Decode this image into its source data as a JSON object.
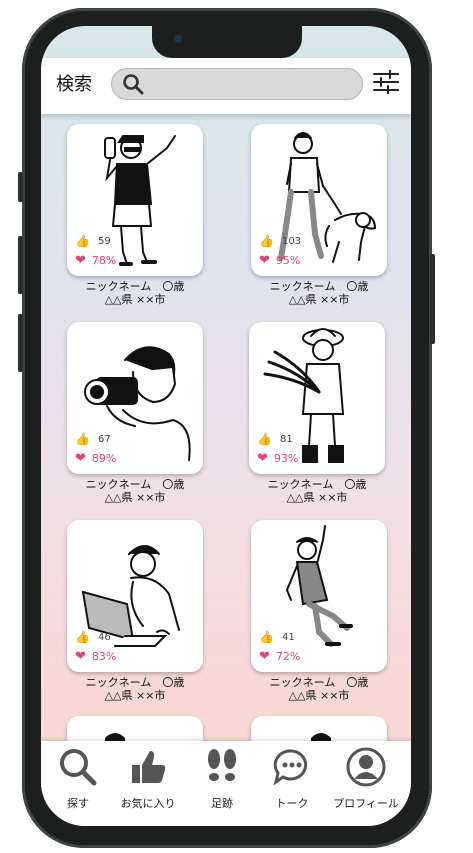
{
  "header": {
    "title": "検索",
    "search_placeholder": ""
  },
  "cards": [
    {
      "likes": "59",
      "rate": "78%",
      "name": "ニックネーム　〇歳",
      "place": "△△県 ××市",
      "illustration": "man-holding-bottle"
    },
    {
      "likes": "103",
      "rate": "95%",
      "name": "ニックネーム　〇歳",
      "place": "△△県 ××市",
      "illustration": "man-walking-dog"
    },
    {
      "likes": "67",
      "rate": "89%",
      "name": "ニックネーム　〇歳",
      "place": "△△県 ××市",
      "illustration": "man-with-camera"
    },
    {
      "likes": "81",
      "rate": "93%",
      "name": "ニックネーム　〇歳",
      "place": "△△県 ××市",
      "illustration": "farmer-with-crops"
    },
    {
      "likes": "46",
      "rate": "83%",
      "name": "ニックネーム　〇歳",
      "place": "△△県 ××市",
      "illustration": "man-at-laptop"
    },
    {
      "likes": "41",
      "rate": "72%",
      "name": "ニックネーム　〇歳",
      "place": "△△県 ××市",
      "illustration": "businessman-jumping"
    }
  ],
  "tabs": [
    {
      "label": "探す",
      "icon": "search-icon"
    },
    {
      "label": "お気に入り",
      "icon": "thumbs-up-icon"
    },
    {
      "label": "足跡",
      "icon": "footprints-icon"
    },
    {
      "label": "トーク",
      "icon": "chat-bubble-icon"
    },
    {
      "label": "プロフィール",
      "icon": "profile-icon"
    }
  ],
  "colors": {
    "accent": "#e0457b",
    "tab_icon": "#555555"
  }
}
